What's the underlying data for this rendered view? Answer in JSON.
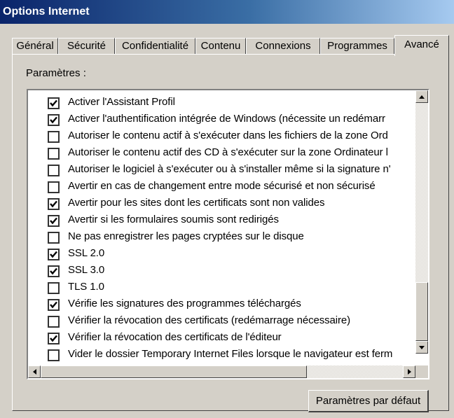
{
  "window": {
    "title": "Options Internet"
  },
  "tabs": [
    {
      "label": "Général"
    },
    {
      "label": "Sécurité"
    },
    {
      "label": "Confidentialité"
    },
    {
      "label": "Contenu"
    },
    {
      "label": "Connexions"
    },
    {
      "label": "Programmes"
    },
    {
      "label": "Avancé",
      "active": true
    }
  ],
  "settings": {
    "label": "Paramètres :",
    "items": [
      {
        "label": "Activer l'Assistant Profil",
        "checked": true
      },
      {
        "label": "Activer l'authentification intégrée de Windows (nécessite un redémarr",
        "checked": true
      },
      {
        "label": "Autoriser le contenu actif à s'exécuter dans les fichiers de la zone Ord",
        "checked": false
      },
      {
        "label": "Autoriser le contenu actif des CD à s'exécuter sur la zone Ordinateur l",
        "checked": false
      },
      {
        "label": "Autoriser le logiciel à s'exécuter ou à s'installer même si la signature n'",
        "checked": false
      },
      {
        "label": "Avertir en cas de changement entre mode sécurisé et non sécurisé",
        "checked": false
      },
      {
        "label": "Avertir pour les sites dont les certificats sont non valides",
        "checked": true
      },
      {
        "label": "Avertir si les formulaires soumis sont redirigés",
        "checked": true
      },
      {
        "label": "Ne pas enregistrer les pages cryptées sur le disque",
        "checked": false
      },
      {
        "label": "SSL 2.0",
        "checked": true
      },
      {
        "label": "SSL 3.0",
        "checked": true
      },
      {
        "label": "TLS 1.0",
        "checked": false
      },
      {
        "label": "Vérifie les signatures des programmes téléchargés",
        "checked": true
      },
      {
        "label": "Vérifier la révocation des certificats (redémarrage nécessaire)",
        "checked": false
      },
      {
        "label": "Vérifier la révocation des certificats de l'éditeur",
        "checked": true
      },
      {
        "label": "Vider le dossier Temporary Internet Files lorsque le navigateur est ferm",
        "checked": false
      }
    ],
    "scroll": {
      "vertical_position": 1.0,
      "horizontal_position": 0.0
    }
  },
  "buttons": {
    "restore_defaults": "Paramètres par défaut"
  }
}
